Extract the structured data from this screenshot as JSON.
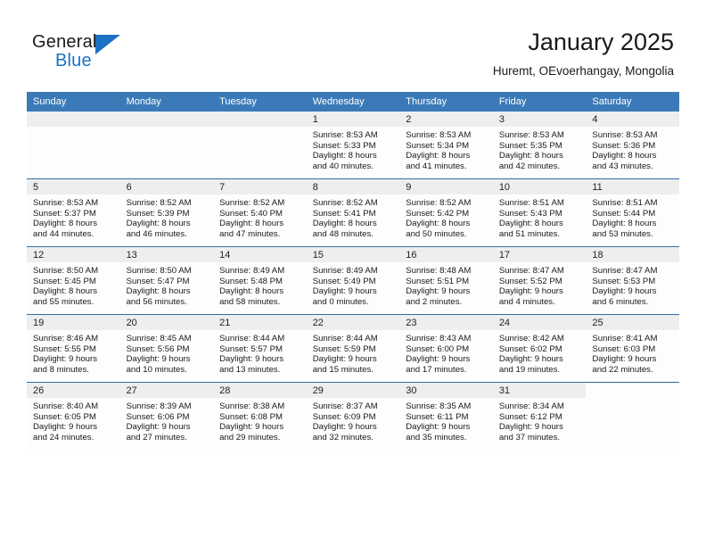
{
  "brand": {
    "word_one": "General",
    "word_two": "Blue",
    "accent_color": "#1c71c4"
  },
  "header": {
    "title": "January 2025",
    "subtitle": "Huremt, OEvoerhangay, Mongolia"
  },
  "theme": {
    "header_blue": "#3b7ab8",
    "row_divider": "#2e6da4",
    "daynum_band": "#eeeeee"
  },
  "calendar": {
    "weekdays": [
      "Sunday",
      "Monday",
      "Tuesday",
      "Wednesday",
      "Thursday",
      "Friday",
      "Saturday"
    ],
    "weeks": [
      [
        {
          "day": "",
          "lines": []
        },
        {
          "day": "",
          "lines": []
        },
        {
          "day": "",
          "lines": []
        },
        {
          "day": "1",
          "lines": [
            "Sunrise: 8:53 AM",
            "Sunset: 5:33 PM",
            "Daylight: 8 hours",
            "and 40 minutes."
          ]
        },
        {
          "day": "2",
          "lines": [
            "Sunrise: 8:53 AM",
            "Sunset: 5:34 PM",
            "Daylight: 8 hours",
            "and 41 minutes."
          ]
        },
        {
          "day": "3",
          "lines": [
            "Sunrise: 8:53 AM",
            "Sunset: 5:35 PM",
            "Daylight: 8 hours",
            "and 42 minutes."
          ]
        },
        {
          "day": "4",
          "lines": [
            "Sunrise: 8:53 AM",
            "Sunset: 5:36 PM",
            "Daylight: 8 hours",
            "and 43 minutes."
          ]
        }
      ],
      [
        {
          "day": "5",
          "lines": [
            "Sunrise: 8:53 AM",
            "Sunset: 5:37 PM",
            "Daylight: 8 hours",
            "and 44 minutes."
          ]
        },
        {
          "day": "6",
          "lines": [
            "Sunrise: 8:52 AM",
            "Sunset: 5:39 PM",
            "Daylight: 8 hours",
            "and 46 minutes."
          ]
        },
        {
          "day": "7",
          "lines": [
            "Sunrise: 8:52 AM",
            "Sunset: 5:40 PM",
            "Daylight: 8 hours",
            "and 47 minutes."
          ]
        },
        {
          "day": "8",
          "lines": [
            "Sunrise: 8:52 AM",
            "Sunset: 5:41 PM",
            "Daylight: 8 hours",
            "and 48 minutes."
          ]
        },
        {
          "day": "9",
          "lines": [
            "Sunrise: 8:52 AM",
            "Sunset: 5:42 PM",
            "Daylight: 8 hours",
            "and 50 minutes."
          ]
        },
        {
          "day": "10",
          "lines": [
            "Sunrise: 8:51 AM",
            "Sunset: 5:43 PM",
            "Daylight: 8 hours",
            "and 51 minutes."
          ]
        },
        {
          "day": "11",
          "lines": [
            "Sunrise: 8:51 AM",
            "Sunset: 5:44 PM",
            "Daylight: 8 hours",
            "and 53 minutes."
          ]
        }
      ],
      [
        {
          "day": "12",
          "lines": [
            "Sunrise: 8:50 AM",
            "Sunset: 5:45 PM",
            "Daylight: 8 hours",
            "and 55 minutes."
          ]
        },
        {
          "day": "13",
          "lines": [
            "Sunrise: 8:50 AM",
            "Sunset: 5:47 PM",
            "Daylight: 8 hours",
            "and 56 minutes."
          ]
        },
        {
          "day": "14",
          "lines": [
            "Sunrise: 8:49 AM",
            "Sunset: 5:48 PM",
            "Daylight: 8 hours",
            "and 58 minutes."
          ]
        },
        {
          "day": "15",
          "lines": [
            "Sunrise: 8:49 AM",
            "Sunset: 5:49 PM",
            "Daylight: 9 hours",
            "and 0 minutes."
          ]
        },
        {
          "day": "16",
          "lines": [
            "Sunrise: 8:48 AM",
            "Sunset: 5:51 PM",
            "Daylight: 9 hours",
            "and 2 minutes."
          ]
        },
        {
          "day": "17",
          "lines": [
            "Sunrise: 8:47 AM",
            "Sunset: 5:52 PM",
            "Daylight: 9 hours",
            "and 4 minutes."
          ]
        },
        {
          "day": "18",
          "lines": [
            "Sunrise: 8:47 AM",
            "Sunset: 5:53 PM",
            "Daylight: 9 hours",
            "and 6 minutes."
          ]
        }
      ],
      [
        {
          "day": "19",
          "lines": [
            "Sunrise: 8:46 AM",
            "Sunset: 5:55 PM",
            "Daylight: 9 hours",
            "and 8 minutes."
          ]
        },
        {
          "day": "20",
          "lines": [
            "Sunrise: 8:45 AM",
            "Sunset: 5:56 PM",
            "Daylight: 9 hours",
            "and 10 minutes."
          ]
        },
        {
          "day": "21",
          "lines": [
            "Sunrise: 8:44 AM",
            "Sunset: 5:57 PM",
            "Daylight: 9 hours",
            "and 13 minutes."
          ]
        },
        {
          "day": "22",
          "lines": [
            "Sunrise: 8:44 AM",
            "Sunset: 5:59 PM",
            "Daylight: 9 hours",
            "and 15 minutes."
          ]
        },
        {
          "day": "23",
          "lines": [
            "Sunrise: 8:43 AM",
            "Sunset: 6:00 PM",
            "Daylight: 9 hours",
            "and 17 minutes."
          ]
        },
        {
          "day": "24",
          "lines": [
            "Sunrise: 8:42 AM",
            "Sunset: 6:02 PM",
            "Daylight: 9 hours",
            "and 19 minutes."
          ]
        },
        {
          "day": "25",
          "lines": [
            "Sunrise: 8:41 AM",
            "Sunset: 6:03 PM",
            "Daylight: 9 hours",
            "and 22 minutes."
          ]
        }
      ],
      [
        {
          "day": "26",
          "lines": [
            "Sunrise: 8:40 AM",
            "Sunset: 6:05 PM",
            "Daylight: 9 hours",
            "and 24 minutes."
          ]
        },
        {
          "day": "27",
          "lines": [
            "Sunrise: 8:39 AM",
            "Sunset: 6:06 PM",
            "Daylight: 9 hours",
            "and 27 minutes."
          ]
        },
        {
          "day": "28",
          "lines": [
            "Sunrise: 8:38 AM",
            "Sunset: 6:08 PM",
            "Daylight: 9 hours",
            "and 29 minutes."
          ]
        },
        {
          "day": "29",
          "lines": [
            "Sunrise: 8:37 AM",
            "Sunset: 6:09 PM",
            "Daylight: 9 hours",
            "and 32 minutes."
          ]
        },
        {
          "day": "30",
          "lines": [
            "Sunrise: 8:35 AM",
            "Sunset: 6:11 PM",
            "Daylight: 9 hours",
            "and 35 minutes."
          ]
        },
        {
          "day": "31",
          "lines": [
            "Sunrise: 8:34 AM",
            "Sunset: 6:12 PM",
            "Daylight: 9 hours",
            "and 37 minutes."
          ]
        },
        {
          "day": "",
          "lines": []
        }
      ]
    ]
  }
}
